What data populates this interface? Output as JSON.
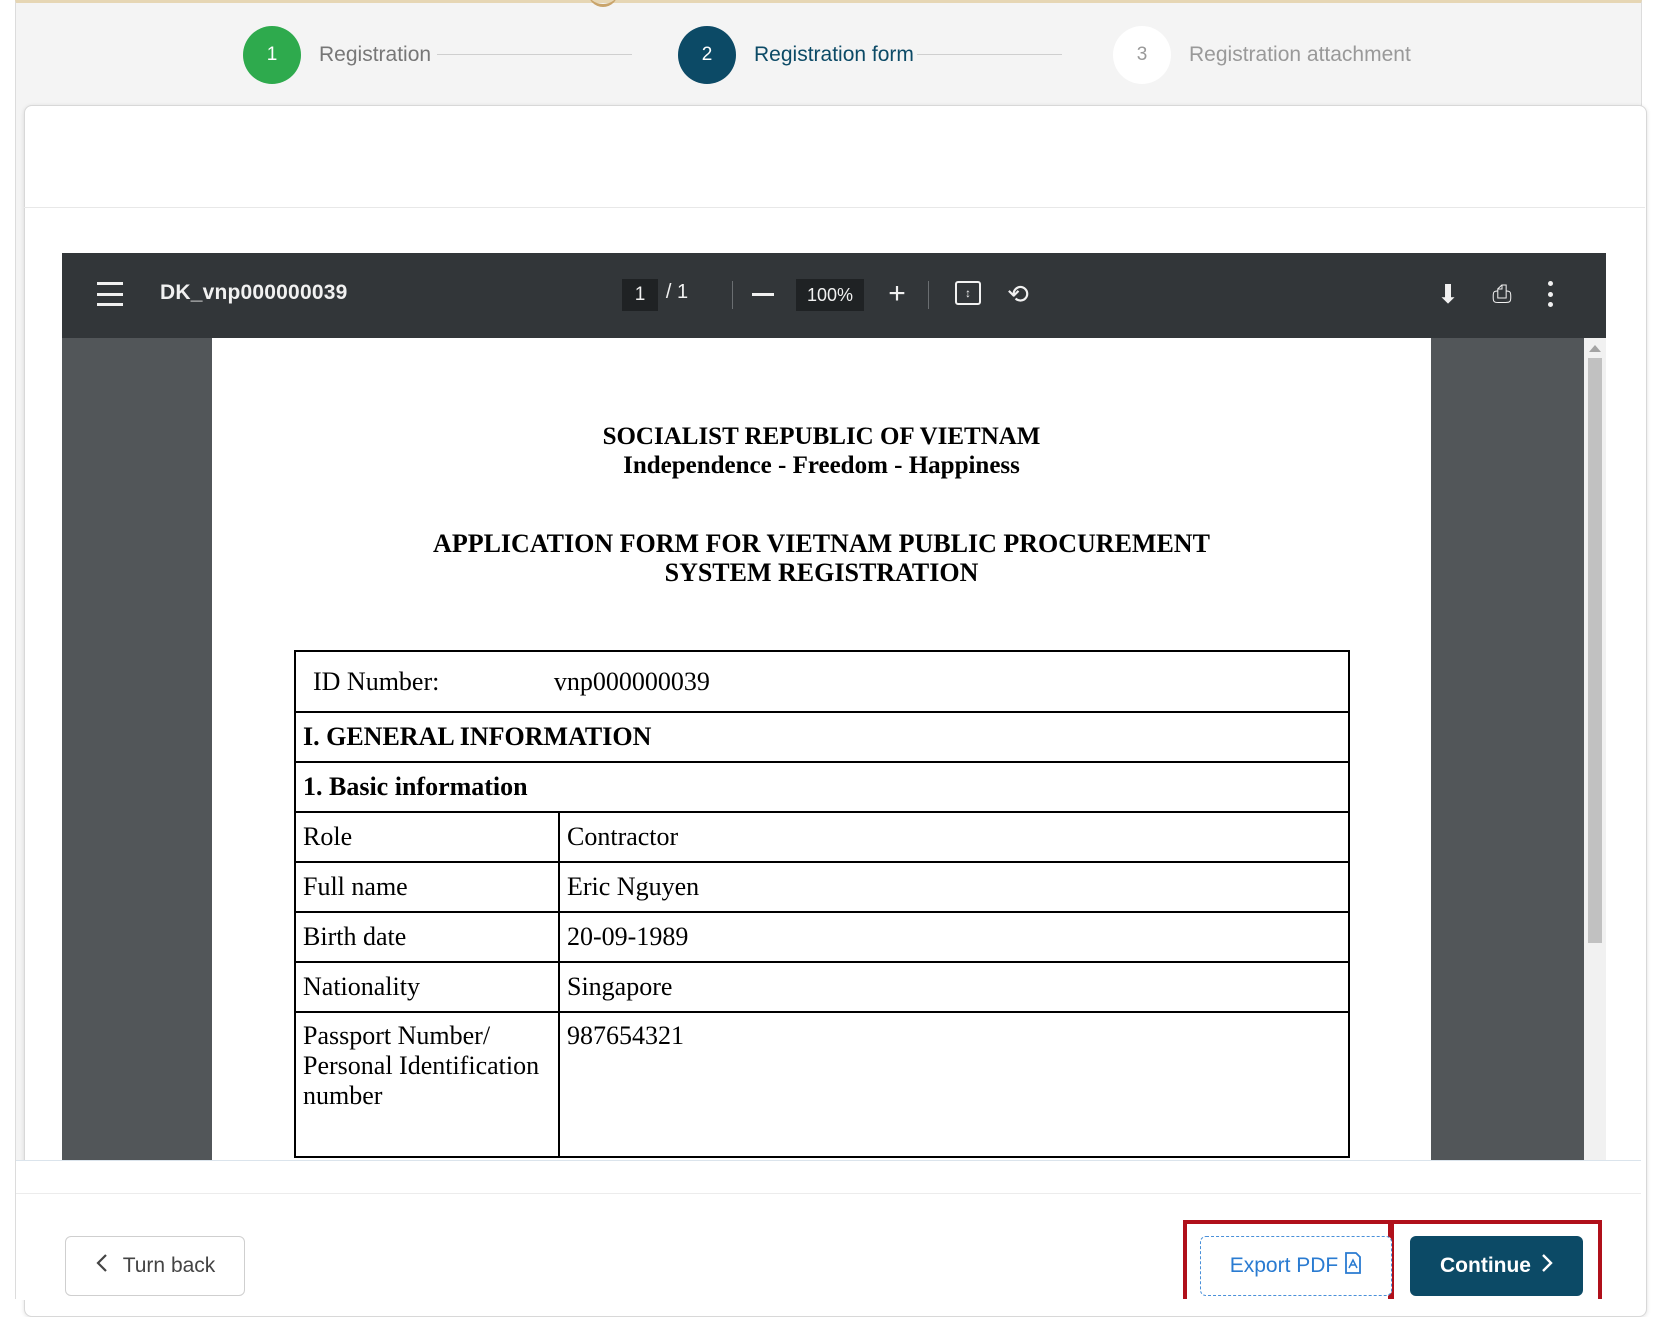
{
  "stepper": {
    "steps": [
      {
        "number": "1",
        "label": "Registration",
        "state": "completed"
      },
      {
        "number": "2",
        "label": "Registration form",
        "state": "active"
      },
      {
        "number": "3",
        "label": "Registration attachment",
        "state": "pending"
      }
    ]
  },
  "viewer": {
    "file_title": "DK_vnp000000039",
    "current_page": "1",
    "page_separator": "/ 1",
    "zoom": "100%",
    "icons": [
      "menu-icon",
      "zoom-out-icon",
      "zoom-in-icon",
      "fit-page-icon",
      "rotate-icon",
      "download-icon",
      "print-icon",
      "more-options-icon"
    ]
  },
  "document": {
    "nation": "SOCIALIST REPUBLIC OF VIETNAM",
    "motto": "Independence - Freedom - Happiness",
    "title_line1": "APPLICATION FORM FOR VIETNAM PUBLIC PROCUREMENT",
    "title_line2": "SYSTEM REGISTRATION",
    "id_label": "ID Number:",
    "id_value": "vnp000000039",
    "section_general": "I. GENERAL INFORMATION",
    "section_basic": "1. Basic information",
    "rows": [
      {
        "key": "Role",
        "value": "Contractor"
      },
      {
        "key": "Full name",
        "value": "Eric Nguyen"
      },
      {
        "key": "Birth date",
        "value": "20-09-1989"
      },
      {
        "key": "Nationality",
        "value": "Singapore"
      },
      {
        "key": "Passport Number/ Personal Identification number",
        "value": "987654321"
      }
    ]
  },
  "footer": {
    "turn_back_label": "Turn back",
    "export_label": "Export PDF",
    "continue_label": "Continue"
  },
  "colors": {
    "primary": "#0c4a66",
    "success": "#2eaa4d",
    "highlight": "#b0101a",
    "link": "#2a7bd1"
  }
}
